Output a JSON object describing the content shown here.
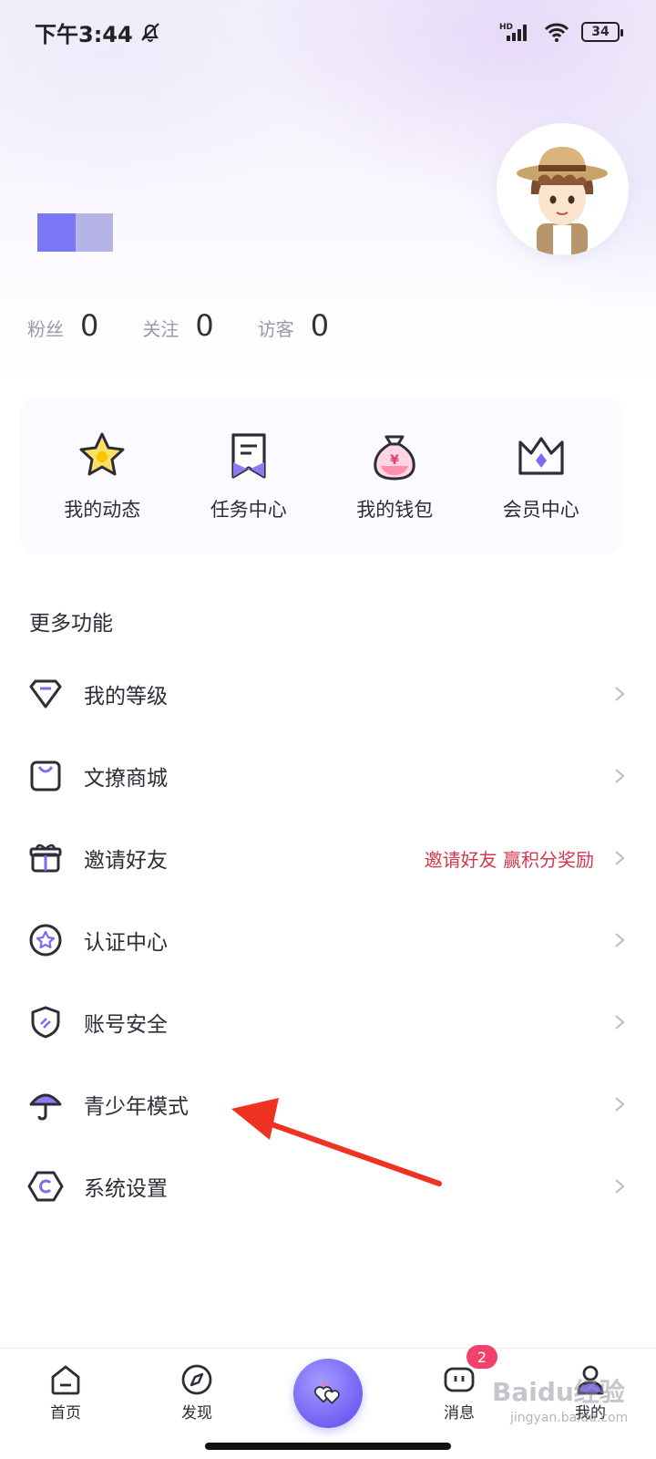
{
  "status_bar": {
    "time": "下午3:44",
    "battery": "34",
    "network": "HD"
  },
  "profile": {
    "stats": [
      {
        "label": "粉丝",
        "value": "0"
      },
      {
        "label": "关注",
        "value": "0"
      },
      {
        "label": "访客",
        "value": "0"
      }
    ]
  },
  "quick_actions": [
    {
      "label": "我的动态",
      "icon": "star-icon"
    },
    {
      "label": "任务中心",
      "icon": "bookmark-icon"
    },
    {
      "label": "我的钱包",
      "icon": "money-bag-icon"
    },
    {
      "label": "会员中心",
      "icon": "crown-icon"
    }
  ],
  "more": {
    "title": "更多功能",
    "items": [
      {
        "label": "我的等级",
        "icon": "diamond-icon"
      },
      {
        "label": "文撩商城",
        "icon": "shopping-bag-icon"
      },
      {
        "label": "邀请好友",
        "icon": "gift-icon",
        "hint": "邀请好友 赢积分奖励"
      },
      {
        "label": "认证中心",
        "icon": "certified-star-icon"
      },
      {
        "label": "账号安全",
        "icon": "shield-icon"
      },
      {
        "label": "青少年模式",
        "icon": "umbrella-icon"
      },
      {
        "label": "系统设置",
        "icon": "settings-hexagon-icon"
      }
    ]
  },
  "tabbar": {
    "items": [
      {
        "label": "首页",
        "icon": "home-icon"
      },
      {
        "label": "发现",
        "icon": "compass-icon"
      },
      {
        "label": "",
        "icon": "hearts-icon"
      },
      {
        "label": "消息",
        "icon": "message-icon",
        "badge": "2"
      },
      {
        "label": "我的",
        "icon": "profile-icon"
      }
    ]
  },
  "watermark": {
    "main": "Baidu经验",
    "sub": "jingyan.baidu.com"
  },
  "colors": {
    "accent": "#7b6cf5",
    "hint_red": "#d4384e",
    "badge": "#f1426a"
  }
}
